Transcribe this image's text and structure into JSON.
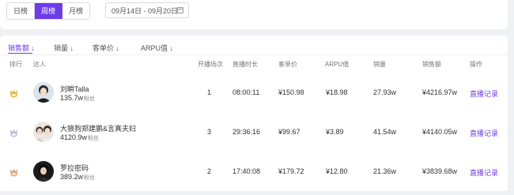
{
  "period_tabs": [
    "日榜",
    "周榜",
    "月榜"
  ],
  "active_period": "周榜",
  "date_range": "09月14日 - 09月20日",
  "sort_tabs": [
    "销售额 ↓",
    "销量 ↓",
    "客单价 ↓",
    "ARPU值 ↓"
  ],
  "active_sort": "销售额 ↓",
  "columns": {
    "rank": "排行",
    "talent": "达人",
    "sessions": "开播场次",
    "duration": "直播时长",
    "unit_price": "客单价",
    "arpu": "ARPU值",
    "sales_volume": "销量",
    "sales_amount": "销售额",
    "action": "操作"
  },
  "rows": [
    {
      "rank_icon": "gold-medal-icon",
      "name": "刘畊Talla",
      "fans": "135.7w",
      "fans_unit": "粉丝",
      "sessions": "1",
      "duration": "08:00:11",
      "unit_price": "¥150.98",
      "arpu": "¥18.98",
      "sales_volume": "27.93w",
      "sales_amount": "¥4216.97w",
      "action": "直播记录"
    },
    {
      "rank_icon": "silver-medal-icon",
      "name": "大狼狗郑建鹏&言真夫妇",
      "fans": "4120.9w",
      "fans_unit": "粉丝",
      "sessions": "3",
      "duration": "29:36:16",
      "unit_price": "¥99.67",
      "arpu": "¥3.89",
      "sales_volume": "41.54w",
      "sales_amount": "¥4140.05w",
      "action": "直播记录"
    },
    {
      "rank_icon": "bronze-medal-icon",
      "name": "罗拉密码",
      "fans": "389.2w",
      "fans_unit": "粉丝",
      "sessions": "2",
      "duration": "17:40:08",
      "unit_price": "¥179.72",
      "arpu": "¥12.80",
      "sales_volume": "21.36w",
      "sales_amount": "¥3839.68w",
      "action": "直播记录"
    }
  ],
  "colors": {
    "accent": "#6c3ce9",
    "gold": "#e8b63a",
    "silver": "#b9bde0",
    "bronze": "#e0a47a"
  }
}
